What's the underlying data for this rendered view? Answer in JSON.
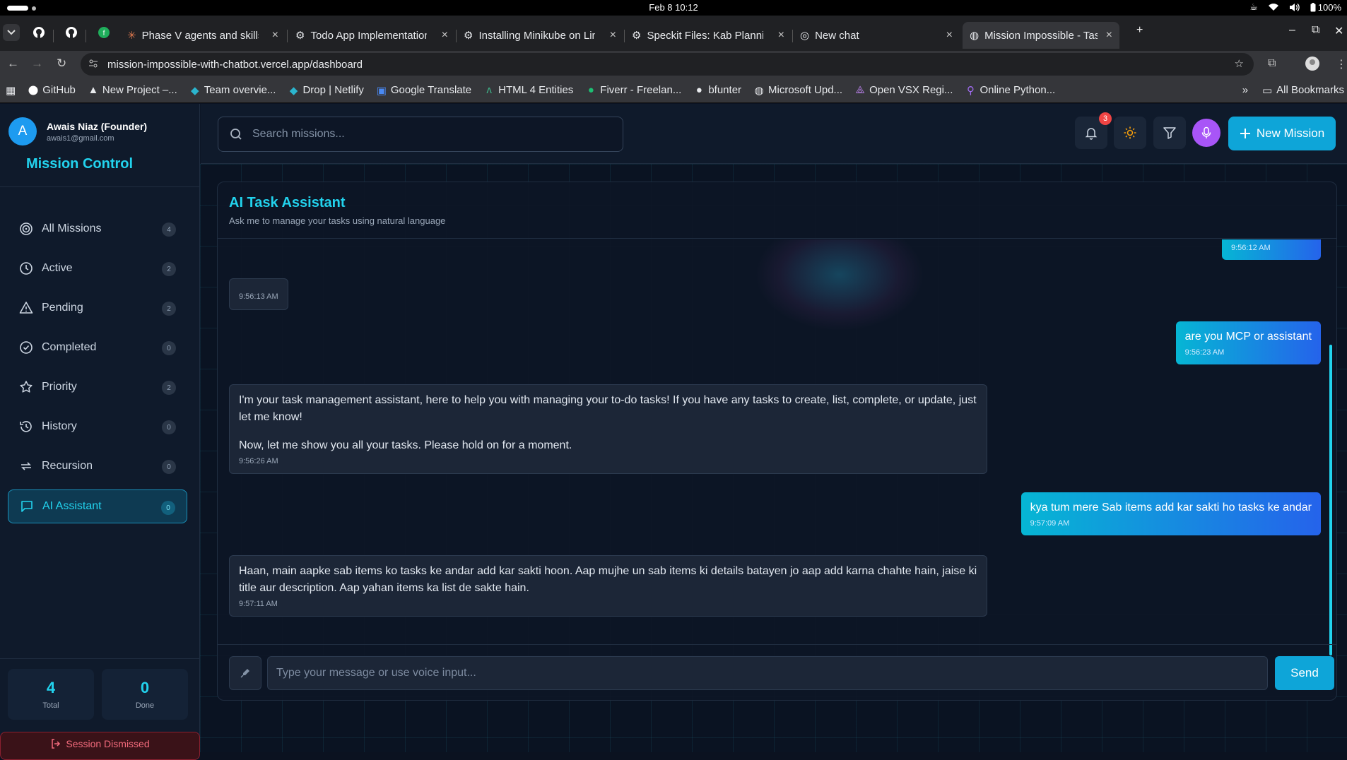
{
  "os": {
    "clock": "Feb 8  10:12",
    "battery": "100%"
  },
  "browser": {
    "tabs": [
      {
        "title": "Phase V agents and skills",
        "icon": "claude-icon"
      },
      {
        "title": "Todo App Implementation",
        "icon": "openai-icon"
      },
      {
        "title": "Installing Minikube on Linux",
        "icon": "openai-icon"
      },
      {
        "title": "Speckit Files: Kab Planning",
        "icon": "openai-icon"
      },
      {
        "title": "New chat",
        "icon": "chat-icon"
      },
      {
        "title": "Mission Impossible - Task",
        "icon": "globe-icon",
        "active": true
      }
    ],
    "url": "mission-impossible-with-chatbot.vercel.app/dashboard",
    "bookmarks": [
      "GitHub",
      "New Project –...",
      "Team overvie...",
      "Drop | Netlify",
      "Google Translate",
      "HTML 4 Entities",
      "Fiverr - Freelan...",
      "bfunter",
      "Microsoft Upd...",
      "Open VSX Regi...",
      "Online Python..."
    ],
    "all_bookmarks": "All Bookmarks",
    "more": "»"
  },
  "user": {
    "initial": "A",
    "name": "Awais Niaz (Founder)",
    "email": "awais1@gmail.com"
  },
  "brand": "Mission Control",
  "nav": [
    {
      "label": "All Missions",
      "count": "4",
      "icon": "target-icon"
    },
    {
      "label": "Active",
      "count": "2",
      "icon": "clock-icon"
    },
    {
      "label": "Pending",
      "count": "2",
      "icon": "warning-icon"
    },
    {
      "label": "Completed",
      "count": "0",
      "icon": "check-circle-icon"
    },
    {
      "label": "Priority",
      "count": "2",
      "icon": "star-icon"
    },
    {
      "label": "History",
      "count": "0",
      "icon": "history-icon"
    },
    {
      "label": "Recursion",
      "count": "0",
      "icon": "repeat-icon"
    },
    {
      "label": "AI Assistant",
      "count": "0",
      "icon": "chat-icon",
      "active": true
    }
  ],
  "stats": {
    "total_value": "4",
    "total_label": "Total",
    "done_value": "0",
    "done_label": "Done"
  },
  "logout": "Session Dismissed",
  "search": {
    "placeholder": "Search missions..."
  },
  "header": {
    "notifications": "3",
    "new_mission": "New Mission"
  },
  "chat": {
    "title": "AI Task Assistant",
    "subtitle": "Ask me to manage your tasks using natural language",
    "messages": [
      {
        "role": "user",
        "text": "",
        "time": "9:56:12 AM"
      },
      {
        "role": "assistant",
        "text": "",
        "time": "9:56:13 AM"
      },
      {
        "role": "user",
        "text": "are you MCP or assistant",
        "time": "9:56:23 AM"
      },
      {
        "role": "assistant",
        "text": "I'm your task management assistant, here to help you with managing your to-do tasks! If you have any tasks to create, list, complete, or update, just let me know!",
        "text2": "Now, let me show you all your tasks. Please hold on for a moment.",
        "time": "9:56:26 AM"
      },
      {
        "role": "user",
        "text": "kya tum mere Sab items add kar sakti ho tasks ke andar",
        "time": "9:57:09 AM"
      },
      {
        "role": "assistant",
        "text": "Haan, main aapke sab items ko tasks ke andar add kar sakti hoon. Aap mujhe un sab items ki details batayen jo aap add karna chahte hain, jaise ki title aur description. Aap yahan items ka list de sakte hain.",
        "time": "9:57:11 AM"
      }
    ],
    "input_placeholder": "Type your message or use voice input...",
    "send": "Send"
  },
  "colors": {
    "accent": "#22d3ee",
    "primary_button": "#0ea5d8",
    "mic": "#a855f7",
    "danger": "#ef4444"
  }
}
